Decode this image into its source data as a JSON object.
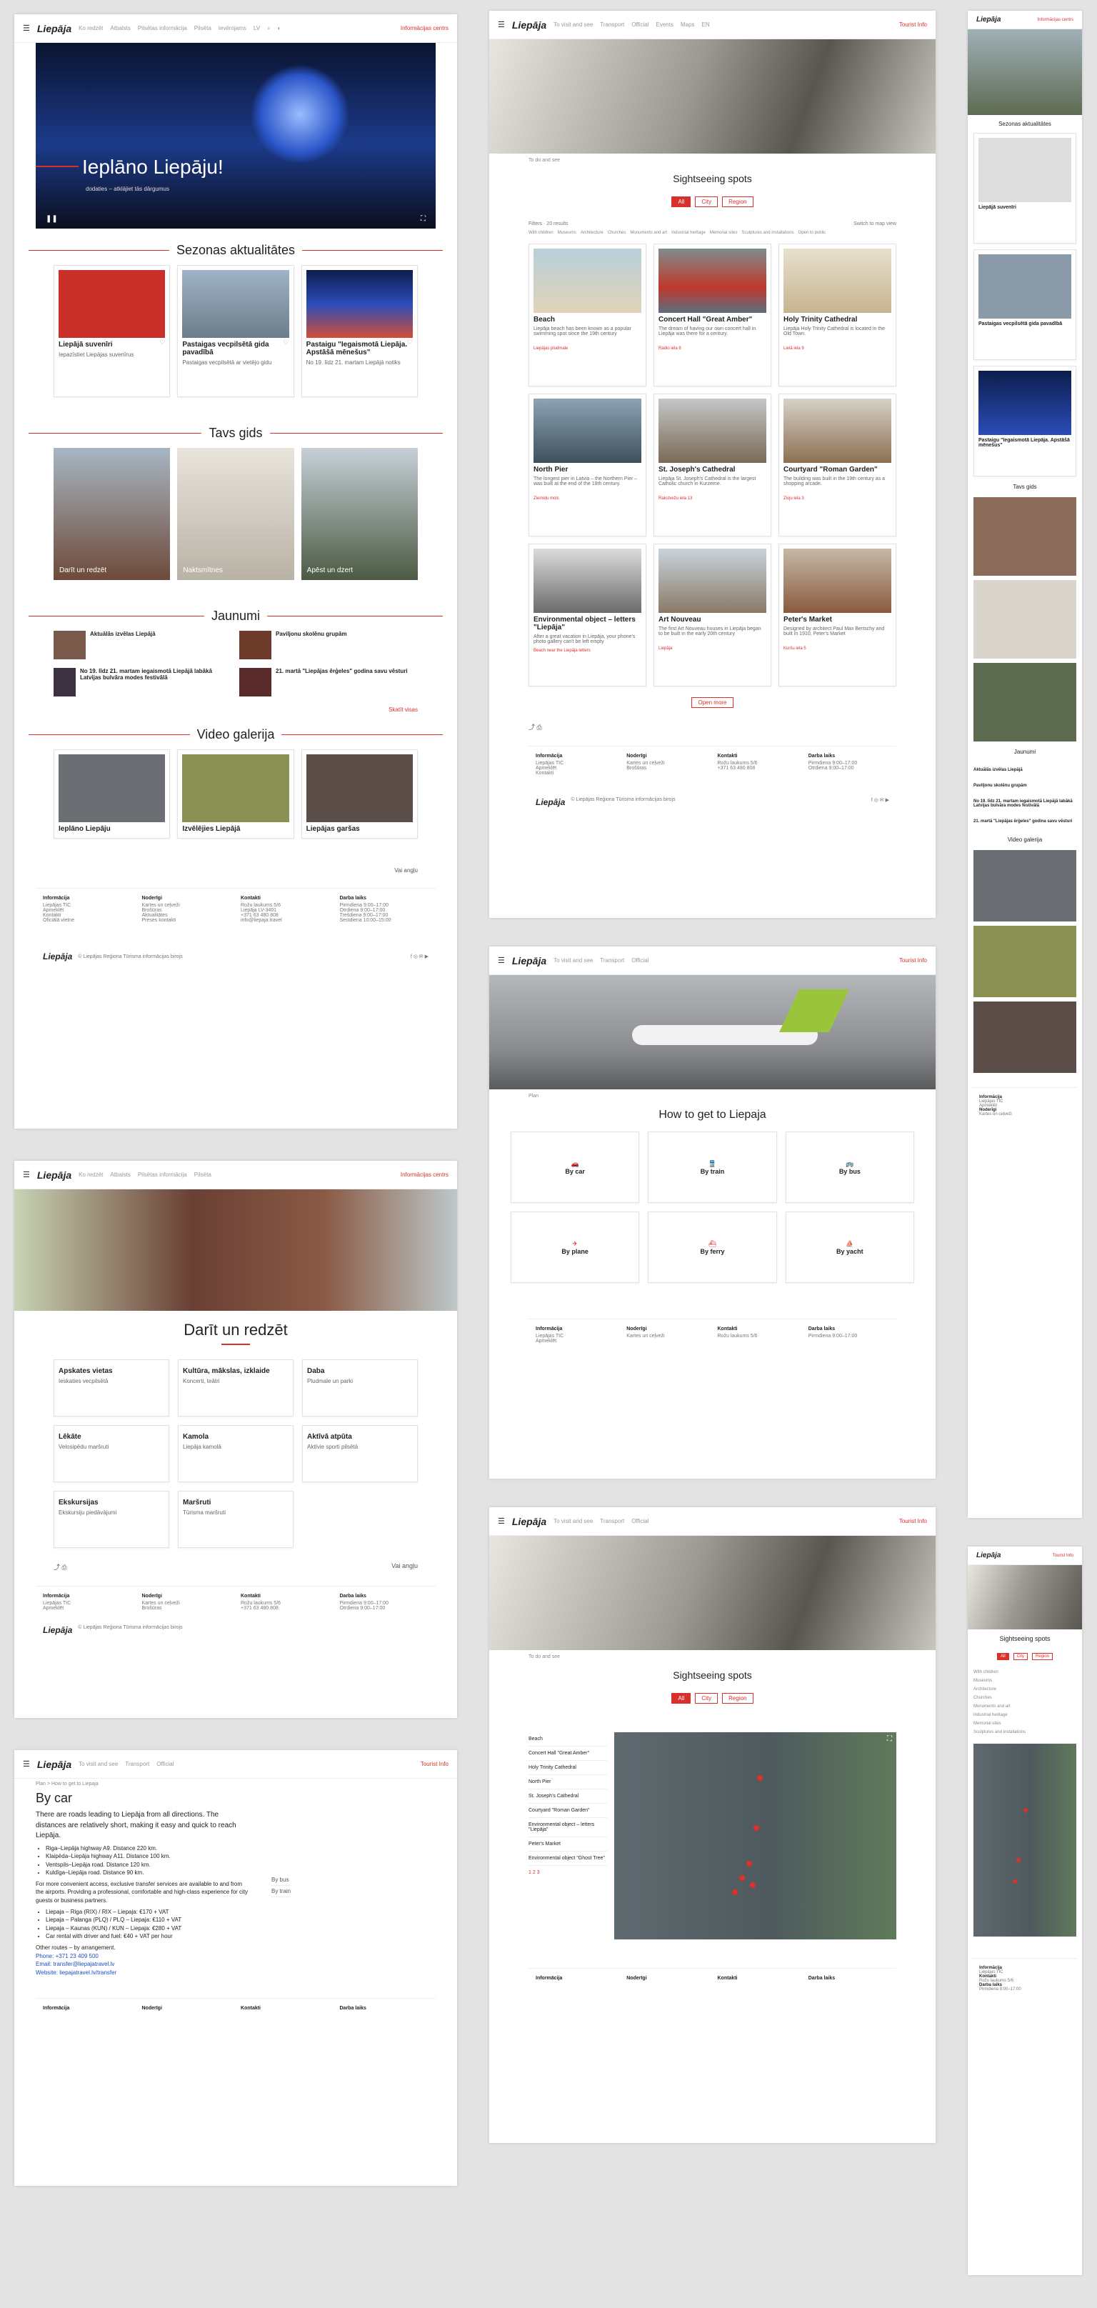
{
  "header": {
    "logo": "Liepāja",
    "nav_lv": [
      "Ko redzēt",
      "Atbalsts",
      "Pilsētas informācija",
      "Pilsēta",
      "Ievērojams"
    ],
    "nav_en": [
      "To visit and see",
      "Transport",
      "Official",
      "Events",
      "Maps"
    ],
    "lang_lv": "LV",
    "lang_en": "EN",
    "phone_link_lv": "Informācijas centrs",
    "phone_link_en": "Tourist Info"
  },
  "hero": {
    "title": "Ieplāno Liepāju!",
    "subtitle": "dodaties – atklājiet tās dārgumus"
  },
  "season": {
    "title": "Sezonas aktualitātes",
    "cards": [
      {
        "title": "Liepājā suvenīri",
        "text": "Iepazīstiet Liepājas suvenīrus"
      },
      {
        "title": "Pastaigas vecpilsētā gida pavadībā",
        "text": "Pastaigas vecpilsētā ar vietējo gidu"
      },
      {
        "title": "Pastaigu \"Iegaismotā Liepāja. Apstāšā mēnešus\"",
        "text": "No 19. līdz 21. martam Liepājā notiks"
      }
    ]
  },
  "guide": {
    "title": "Tavs gids",
    "cards": [
      "Darīt un redzēt",
      "Naktsmītnes",
      "Apēst un dzert"
    ]
  },
  "news": {
    "title": "Jaunumi",
    "items": [
      "Aktuālās izvēlas Liepājā",
      "Paviljonu skolēnu grupām",
      "No 19. līdz 21. martam iegaismotā Liepājā labākā Latvijas bulvāra modes festivālā",
      "21. martā \"Liepājas ērģeles\" godina savu vēsturi"
    ],
    "more": "Skatīt visas"
  },
  "video": {
    "title": "Video galerija",
    "items": [
      "Ieplāno Liepāju",
      "Izvēlējies Liepājā",
      "Liepājas garšas"
    ]
  },
  "lang_select": "Vai angļu",
  "footer": {
    "cols": [
      {
        "title": "Informācija",
        "items": [
          "Liepājas TIC",
          "Apmeklēt",
          "Kontakti",
          "Oficiālā vietne",
          "Ieteikumi"
        ]
      },
      {
        "title": "Noderīgi",
        "items": [
          "Kartes un ceļveži",
          "Brošūras",
          "Aktualitātes",
          "Preses kontakti"
        ]
      },
      {
        "title": "Kontakti",
        "items": [
          "Rožu laukums 5/6",
          "Liepāja LV-3401",
          "+371 63 480 808",
          "info@liepaja.travel"
        ]
      },
      {
        "title": "Darba laiks",
        "items": [
          "Pirmdiena 9:00–17:00",
          "Otrdiena 9:00–17:00",
          "Trešdiena 9:00–17:00",
          "Sestdiena 10:00–15:00"
        ]
      }
    ],
    "copyright": "© Liepājas Reģiona Tūrisma informācijas birojs"
  },
  "todo": {
    "title": "Darīt un redzēt",
    "cards": [
      {
        "title": "Apskates vietas",
        "text": "Ieskaties vecpilsētā"
      },
      {
        "title": "Kultūra, mākslas, izklaide",
        "text": "Koncerti, teātri"
      },
      {
        "title": "Daba",
        "text": "Pludmale un parki"
      },
      {
        "title": "Lēkāte",
        "text": "Velosipēdu maršruti"
      },
      {
        "title": "Kamola",
        "text": "Liepāja kamolā"
      },
      {
        "title": "Aktīvā atpūta",
        "text": "Aktīvie sporti pilsētā"
      },
      {
        "title": "Ekskursijas",
        "text": "Ekskursiju piedāvājumi"
      },
      {
        "title": "Maršruti",
        "text": "Tūrisma maršruti"
      }
    ]
  },
  "sights": {
    "breadcrumb": "To do and see",
    "title": "Sightseeing spots",
    "filters": [
      "All",
      "City",
      "Region"
    ],
    "sort_label": "Filters",
    "results": "20 results",
    "map_toggle": "Switch to map view",
    "checks": [
      "With children",
      "Museums",
      "Architecture",
      "Churches",
      "Monuments and art",
      "Industrial heritage",
      "Memorial sites",
      "Sculptures and installations",
      "Open to public"
    ],
    "cards": [
      {
        "title": "Beach",
        "text": "Liepāja beach has been known as a popular swimming spot since the 19th century",
        "addr": "Liepājas pludmale"
      },
      {
        "title": "Concert Hall \"Great Amber\"",
        "text": "The dream of having our own concert hall in Liepāja was there for a century.",
        "addr": "Radio iela 8"
      },
      {
        "title": "Holy Trinity Cathedral",
        "text": "Liepāja Holy Trinity Cathedral is located in the Old Town.",
        "addr": "Lielā iela 9"
      },
      {
        "title": "North Pier",
        "text": "The longest pier in Latvia – the Northern Pier – was built at the end of the 19th century.",
        "addr": "Ziemeļu mols"
      },
      {
        "title": "St. Joseph's Cathedral",
        "text": "Liepāja St. Joseph's Cathedral is the largest Catholic church in Kurzeme.",
        "addr": "Rakstvežu iela 13"
      },
      {
        "title": "Courtyard \"Roman Garden\"",
        "text": "The building was built in the 19th century as a shopping arcade.",
        "addr": "Zivju iela 3"
      },
      {
        "title": "Environmental object – letters \"Liepāja\"",
        "text": "After a great vacation in Liepāja, your phone's photo gallery can't be left empty",
        "addr": "Beach near the Liepāja letters"
      },
      {
        "title": "Art Nouveau",
        "text": "The first Art Nouveau houses in Liepāja began to be built in the early 20th century",
        "addr": "Liepāja"
      },
      {
        "title": "Peter's Market",
        "text": "Designed by architect Paul Max Bertschy and built in 1910, Peter's Market",
        "addr": "Kuršu iela 5"
      }
    ],
    "more": "Open more",
    "map_list": [
      "Beach",
      "Concert Hall \"Great Amber\"",
      "Holy Trinity Cathedral",
      "North Pier",
      "St. Joseph's Cathedral",
      "Courtyard \"Roman Garden\"",
      "Environmental object – letters \"Liepāja\"",
      "Peter's Market",
      "Environmental object \"Ghost Tree\""
    ],
    "pages": [
      "1",
      "2",
      "3"
    ]
  },
  "getting": {
    "breadcrumb": "Plan",
    "title": "How to get to Liepaja",
    "options": [
      "By car",
      "By train",
      "By bus",
      "By plane",
      "By ferry",
      "By yacht"
    ]
  },
  "bycar": {
    "breadcrumb": "Plan > How to get to Liepaja",
    "title": "By car",
    "intro": "There are roads leading to Liepāja from all directions. The distances are relatively short, making it easy and quick to reach Liepāja.",
    "bullets": [
      "Riga–Liepāja highway A9. Distance 220 km.",
      "Klaipēda–Liepāja highway A11. Distance 100 km.",
      "Ventspils–Liepāja road. Distance 120 km.",
      "Kuldīga–Liepāja road. Distance 90 km."
    ],
    "para": "For more convenient access, exclusive transfer services are available to and from the airports. Providing a professional, comfortable and high-class experience for city guests or business partners.",
    "bullets2": [
      "Liepaja – Riga (RIX) / RIX – Liepaja: €170 + VAT",
      "Liepaja – Palanga (PLQ) / PLQ – Liepaja: €110 + VAT",
      "Liepaja – Kaunas (KUN) / KUN – Liepaja: €280 + VAT",
      "Car rental with driver and fuel: €40 + VAT per hour"
    ],
    "other": "Other routes – by arrangement.",
    "phone": "Phone: +371 23 409 500",
    "email": "Email: transfer@liepajatravel.lv",
    "website": "Website: liepajatravel.lv/transfer",
    "side_links": [
      "By bus",
      "By train"
    ]
  },
  "mobile": {
    "season_title": "Sezonas aktualitātes",
    "guide_title": "Tavs gids",
    "news_title": "Jaunumi",
    "video_title": "Video galerija",
    "sights_title": "Sightseeing spots"
  }
}
